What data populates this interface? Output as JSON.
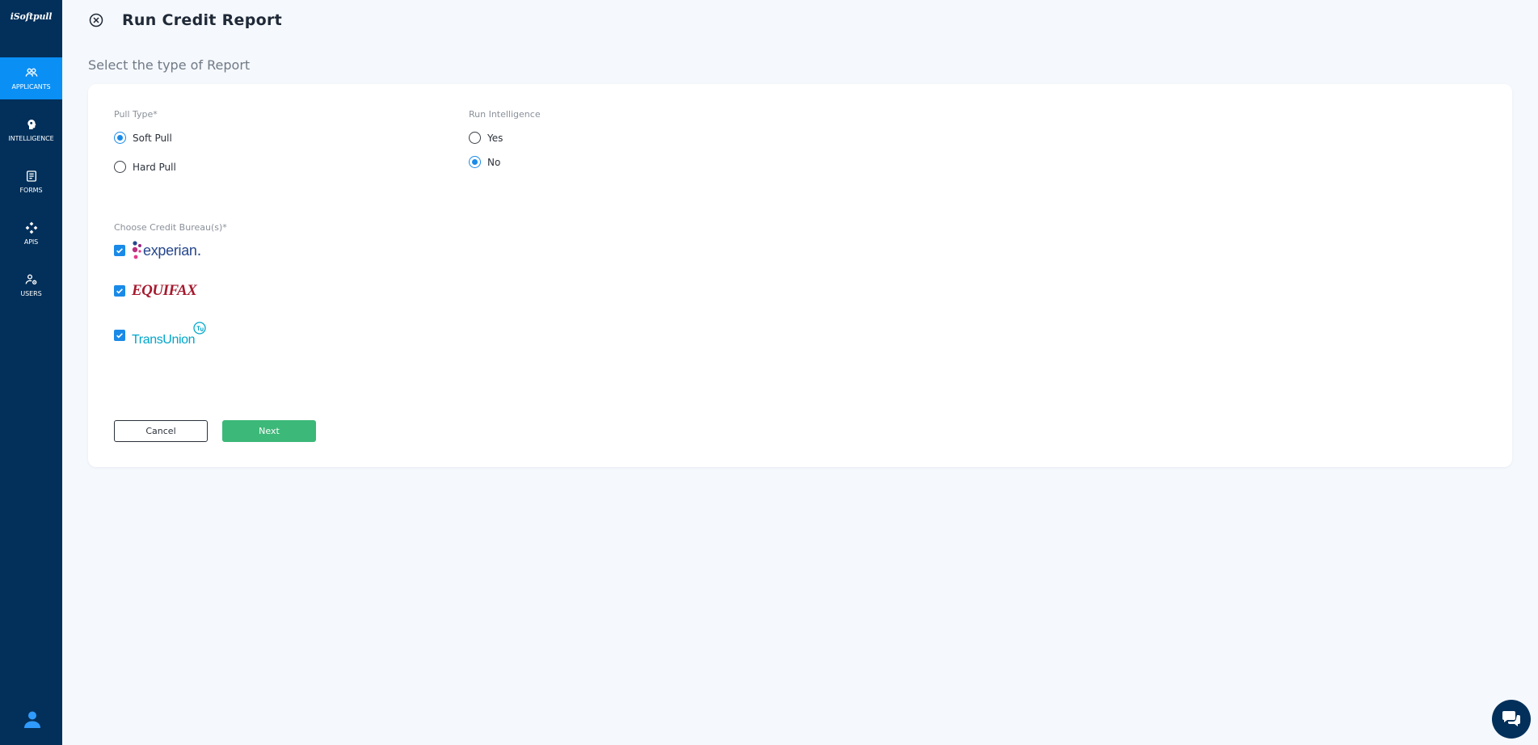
{
  "brand": {
    "name": "iSoftpull"
  },
  "sidebar": {
    "items": [
      {
        "label": "APPLICANTS",
        "icon": "users-icon",
        "active": true
      },
      {
        "label": "INTELLIGENCE",
        "icon": "brain-head-icon",
        "active": false
      },
      {
        "label": "FORMS",
        "icon": "form-icon",
        "active": false
      },
      {
        "label": "APIS",
        "icon": "api-icon",
        "active": false
      },
      {
        "label": "USERS",
        "icon": "user-gear-icon",
        "active": false
      }
    ],
    "profile_icon": "user-avatar-icon"
  },
  "header": {
    "close_icon": "close-circle-icon",
    "title": "Run Credit Report"
  },
  "subtitle": "Select the type of Report",
  "form": {
    "pull_type": {
      "label": "Pull Type*",
      "options": [
        {
          "label": "Soft Pull",
          "checked": true
        },
        {
          "label": "Hard Pull",
          "checked": false
        }
      ]
    },
    "run_intelligence": {
      "label": "Run Intelligence",
      "options": [
        {
          "label": "Yes",
          "checked": false
        },
        {
          "label": "No",
          "checked": true
        }
      ]
    },
    "bureaus": {
      "label": "Choose Credit Bureau(s)*",
      "items": [
        {
          "name": "experian",
          "checked": true
        },
        {
          "name": "EQUIFAX",
          "checked": true
        },
        {
          "name": "TransUnion",
          "checked": true
        }
      ]
    },
    "cancel_label": "Cancel",
    "next_label": "Next"
  },
  "colors": {
    "sidebar_bg": "#03305a",
    "active_nav": "#0a8ff5",
    "accent_blue": "#1a8ae8",
    "next_green": "#3cb878",
    "equifax_red": "#a6192e",
    "transunion_teal": "#00a6ca"
  },
  "chat_icon": "chat-bubbles-icon"
}
